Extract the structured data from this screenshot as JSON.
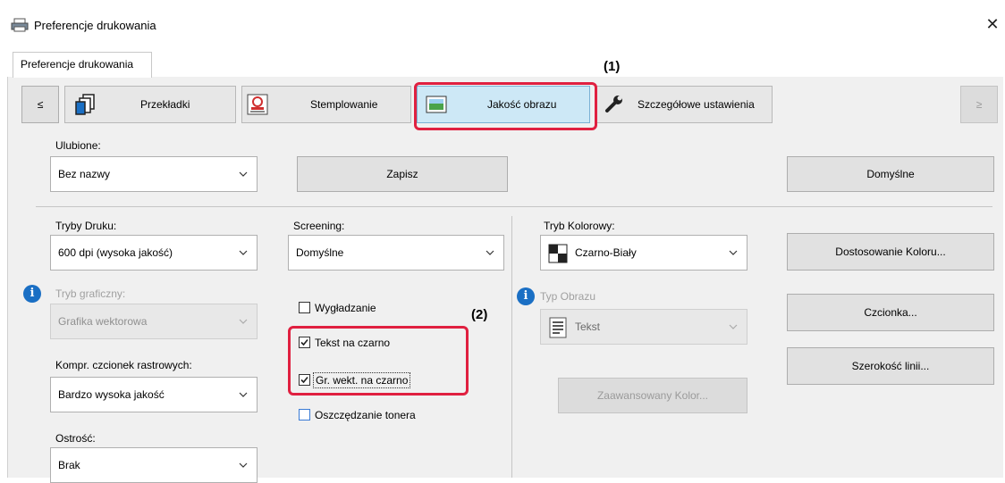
{
  "window": {
    "title": "Preferencje drukowania",
    "close_glyph": "✕"
  },
  "tabs": [
    {
      "label": "Preferencje drukowania"
    }
  ],
  "categories": {
    "prev_glyph": "≤",
    "next_glyph": "≥",
    "items": [
      {
        "label": "Przekładki",
        "icon": "pages-icon"
      },
      {
        "label": "Stemplowanie",
        "icon": "stamp-icon"
      },
      {
        "label": "Jakość obrazu",
        "icon": "image-icon",
        "active": true
      },
      {
        "label": "Szczegółowe ustawienia",
        "icon": "wrench-icon"
      }
    ]
  },
  "favorites": {
    "label": "Ulubione:",
    "value": "Bez nazwy",
    "save_button": "Zapisz",
    "defaults_button": "Domyślne"
  },
  "print_mode": {
    "label": "Tryby Druku:",
    "value": "600 dpi (wysoka jakość)"
  },
  "graphics_mode": {
    "label": "Tryb graficzny:",
    "value": "Grafika wektorowa"
  },
  "bitmap_compression": {
    "label": "Kompr. czcionek rastrowych:",
    "value": "Bardzo wysoka jakość"
  },
  "sharpness": {
    "label": "Ostrość:",
    "value": "Brak"
  },
  "screening": {
    "label": "Screening:",
    "value": "Domyślne"
  },
  "checkboxes": {
    "smoothing": {
      "label": "Wygładzanie",
      "checked": false
    },
    "text_black": {
      "label": "Tekst na czarno",
      "checked": true
    },
    "vector_black": {
      "label": "Gr. wekt. na czarno",
      "checked": true
    },
    "toner_save": {
      "label": "Oszczędzanie tonera",
      "checked": false
    }
  },
  "color_mode": {
    "label": "Tryb Kolorowy:",
    "value": "Czarno-Biały"
  },
  "image_type": {
    "label": "Typ Obrazu",
    "value": "Tekst"
  },
  "advanced_color_button": "Zaawansowany Kolor...",
  "side_buttons": {
    "color_adjust": "Dostosowanie Koloru...",
    "font": "Czcionka...",
    "line_width": "Szerokość linii..."
  },
  "callouts": {
    "one": "(1)",
    "two": "(2)"
  },
  "colors": {
    "accent": "#e02040",
    "active_tab": "#cde8f6",
    "info": "#1a6fc4"
  }
}
